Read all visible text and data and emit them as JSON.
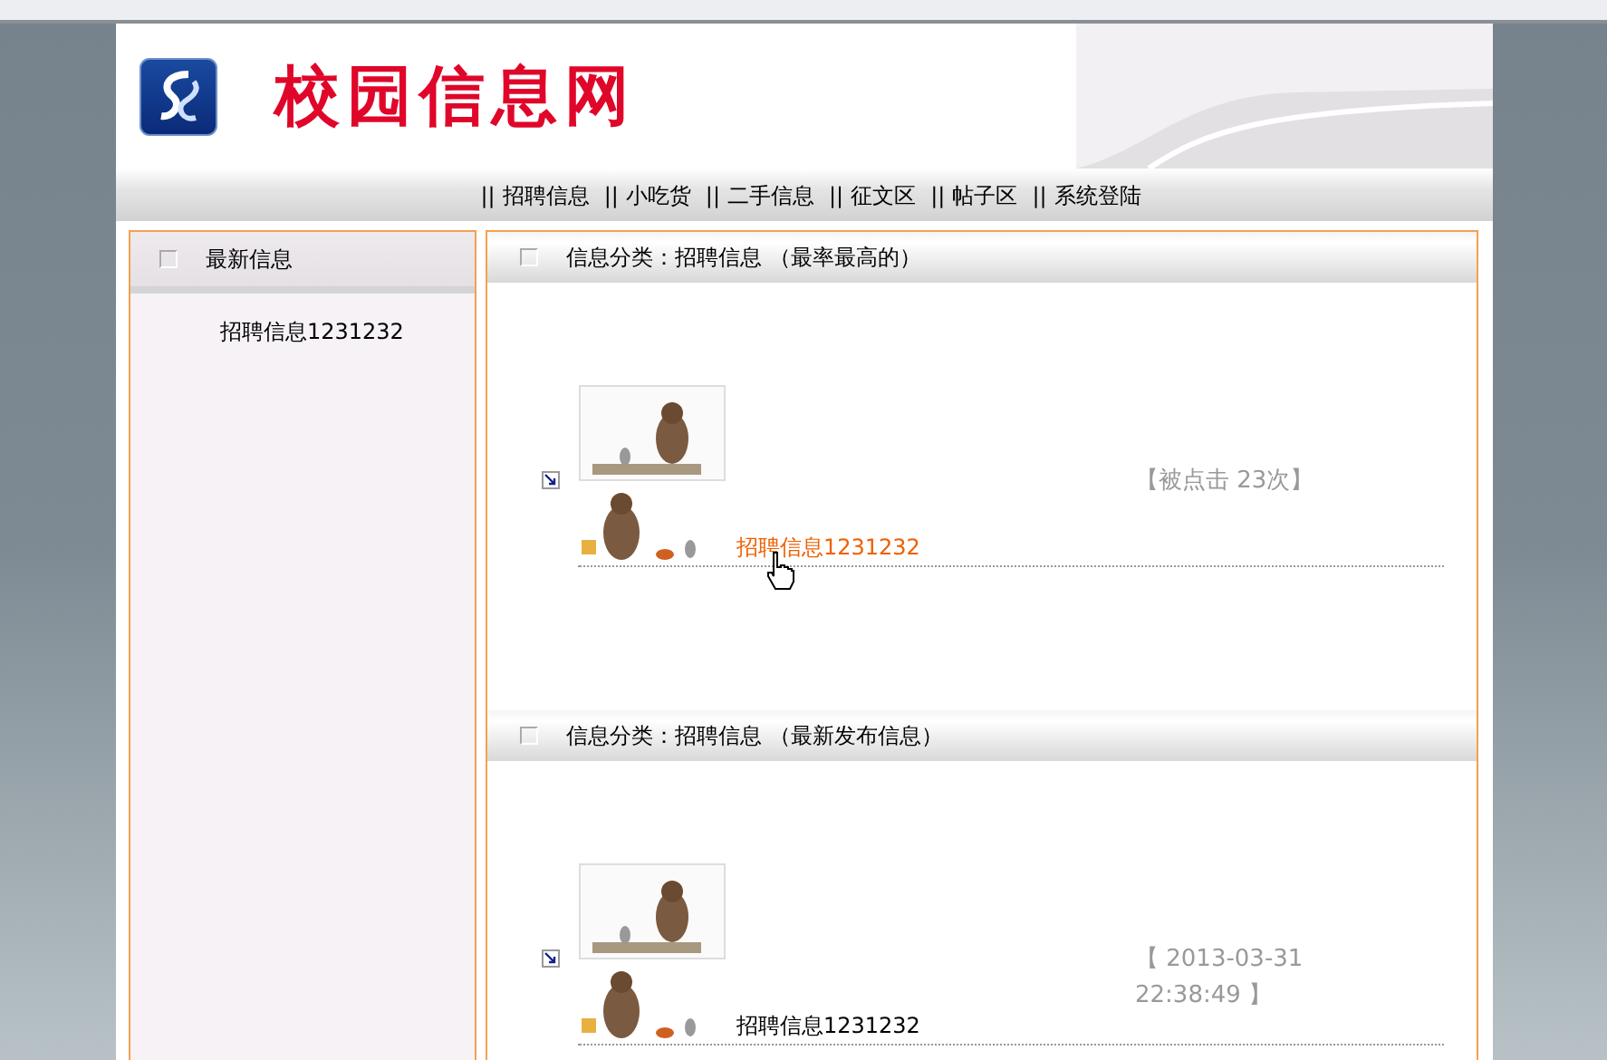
{
  "site": {
    "title": "校园信息网"
  },
  "nav": [
    {
      "sep": "||",
      "label": "招聘信息"
    },
    {
      "sep": "||",
      "label": "小吃货"
    },
    {
      "sep": "||",
      "label": "二手信息"
    },
    {
      "sep": "||",
      "label": "征文区"
    },
    {
      "sep": "||",
      "label": "帖子区"
    },
    {
      "sep": "||",
      "label": "系统登陆"
    }
  ],
  "sidebar": {
    "title": "最新信息",
    "items": [
      "招聘信息1231232"
    ]
  },
  "sections": [
    {
      "title": "信息分类：招聘信息 （最率最高的）",
      "entries": [
        {
          "title": "招聘信息1231232",
          "meta": "【被点击 23次】",
          "hovered": true
        }
      ]
    },
    {
      "title": "信息分类：招聘信息 （最新发布信息）",
      "entries": [
        {
          "title": "招聘信息1231232",
          "meta": "【 2013-03-31 22:38:49 】",
          "hovered": false
        }
      ]
    }
  ]
}
